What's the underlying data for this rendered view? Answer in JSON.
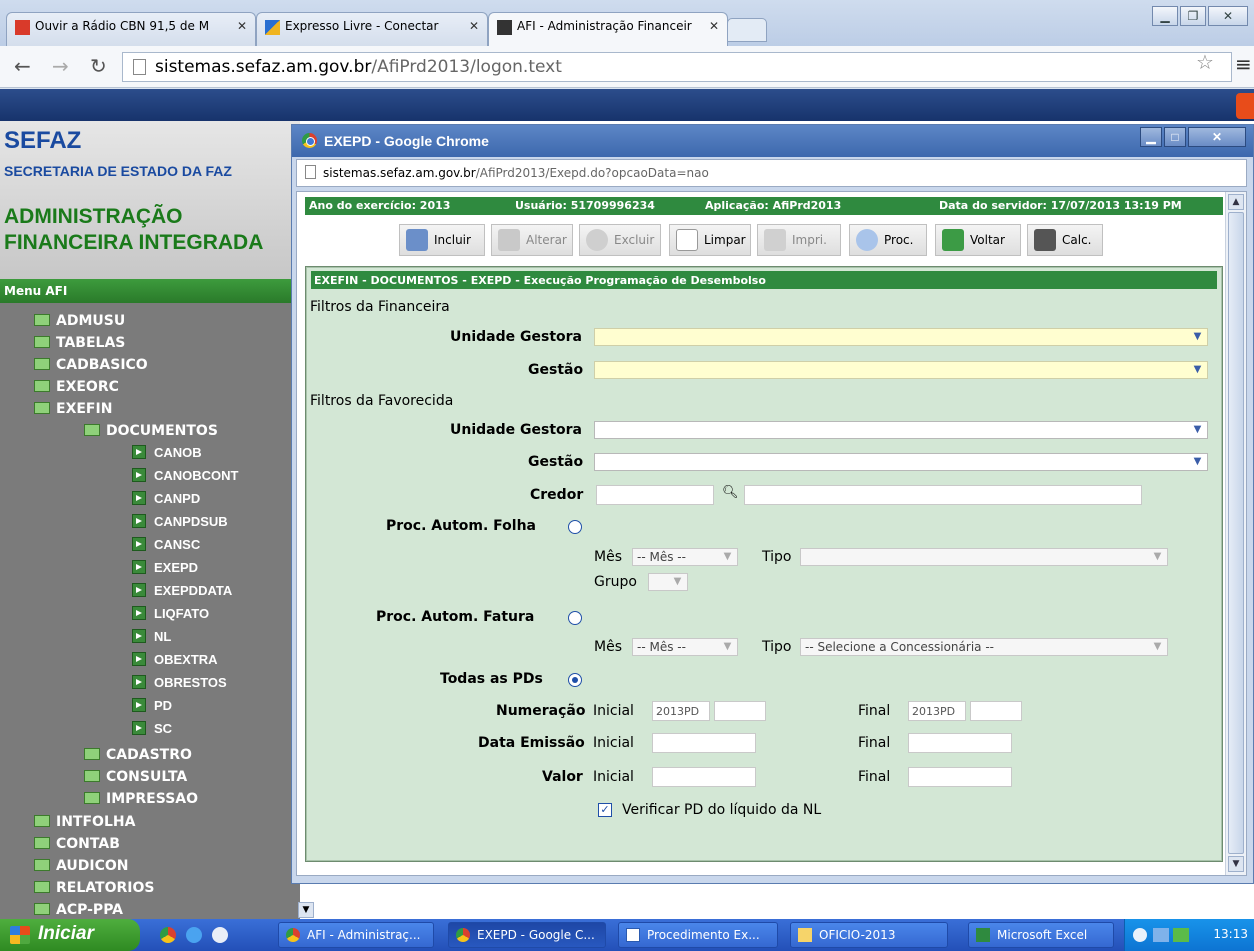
{
  "browser": {
    "tabs": [
      {
        "label": "Ouvir a Rádio CBN 91,5 de M"
      },
      {
        "label": "Expresso Livre - Conectar"
      },
      {
        "label": "AFI - Administração Financeir"
      }
    ],
    "address": {
      "host": "sistemas.sefaz.am.gov.br",
      "path": "/AfiPrd2013/logon.text"
    }
  },
  "background_page": {
    "brand": "SEFAZ",
    "brand_sub": "SECRETARIA DE ESTADO DA FAZ",
    "app_line1": "ADMINISTRAÇÃO",
    "app_line2": "FINANCEIRA INTEGRADA",
    "menu_title": "Menu AFI",
    "menu": {
      "admusu": "ADMUSU",
      "tabelas": "TABELAS",
      "cadbasico": "CADBASICO",
      "exeorc": "EXEORC",
      "exefin": "EXEFIN",
      "documentos": "DOCUMENTOS",
      "docs": [
        "CANOB",
        "CANOBCONT",
        "CANPD",
        "CANPDSUB",
        "CANSC",
        "EXEPD",
        "EXEPDDATA",
        "LIQFATO",
        "NL",
        "OBEXTRA",
        "OBRESTOS",
        "PD",
        "SC"
      ],
      "cadastro": "CADASTRO",
      "consulta": "CONSULTA",
      "impressao": "IMPRESSAO",
      "intfolha": "INTFOLHA",
      "contab": "CONTAB",
      "audicon": "AUDICON",
      "relatorios": "RELATORIOS",
      "acpppa": "ACP-PPA"
    }
  },
  "popup": {
    "title": "EXEPD - Google Chrome",
    "url_host": "sistemas.sefaz.am.gov.br",
    "url_path": "/AfiPrd2013/Exepd.do?opcaoData=nao",
    "status": {
      "ano": "Ano do exercício: 2013",
      "usuario": "Usuário: 51709996234",
      "aplicacao": "Aplicação: AfiPrd2013",
      "data": "Data do servidor: 17/07/2013 13:19 PM"
    },
    "toolbar": {
      "incluir": "Incluir",
      "alterar": "Alterar",
      "excluir": "Excluir",
      "limpar": "Limpar",
      "imprimir": "Impri.",
      "proc": "Proc.",
      "voltar": "Voltar",
      "calc": "Calc."
    },
    "panel_title": "EXEFIN - DOCUMENTOS - EXEPD - Execução Programação de Desembolso",
    "form": {
      "filtros_financeira": "Filtros da Financeira",
      "filtros_favorecida": "Filtros da Favorecida",
      "unidade_gestora": "Unidade Gestora",
      "gestao": "Gestão",
      "credor": "Credor",
      "proc_folha": "Proc. Autom. Folha",
      "proc_fatura": "Proc. Autom. Fatura",
      "todas_pds": "Todas as PDs",
      "mes": "Mês",
      "mes_value": "-- Mês --",
      "tipo": "Tipo",
      "tipo_fatura_value": "-- Selecione a Concessionária --",
      "grupo": "Grupo",
      "numeracao": "Numeração",
      "data_emissao": "Data Emissão",
      "valor": "Valor",
      "inicial": "Inicial",
      "final": "Final",
      "num_prefix": "2013PD",
      "verificar": "Verificar PD do líquido da NL",
      "verificar_checked": true
    }
  },
  "taskbar": {
    "start": "Iniciar",
    "items": [
      "AFI - Administraç...",
      "EXEPD - Google C...",
      "Procedimento Ex...",
      "OFICIO-2013",
      "Microsoft Excel"
    ],
    "clock": "13:13"
  }
}
